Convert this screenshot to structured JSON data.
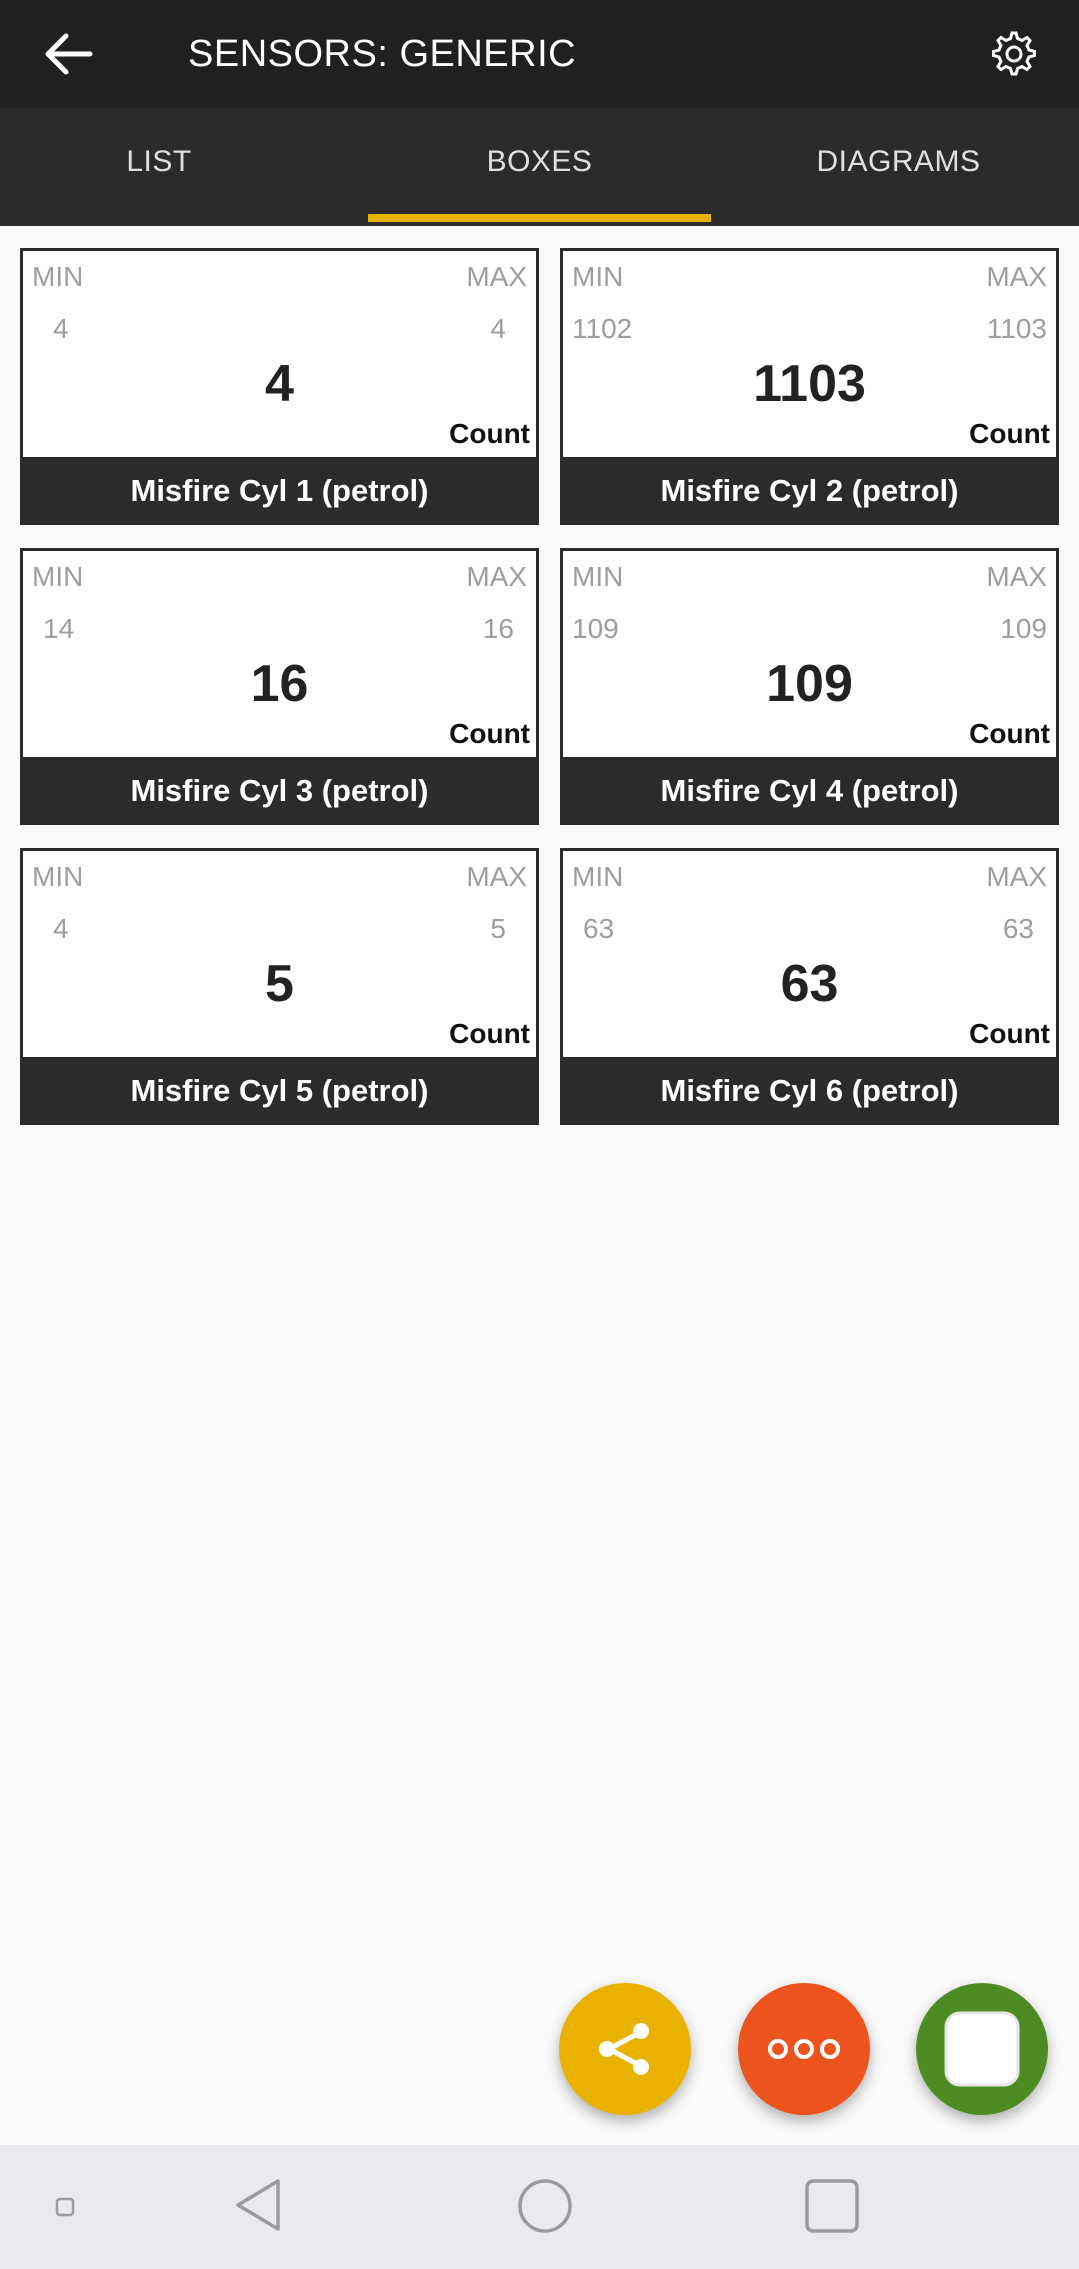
{
  "appbar": {
    "title": "SENSORS: GENERIC",
    "back_icon": "arrow-left-icon",
    "settings_icon": "gear-icon"
  },
  "tabs": [
    {
      "label": "LIST",
      "active": false
    },
    {
      "label": "BOXES",
      "active": true
    },
    {
      "label": "DIAGRAMS",
      "active": false
    }
  ],
  "colors": {
    "appbar": "#202020",
    "tabbar": "#2b2b2b",
    "accent": "#e9b200",
    "share_fab": "#e9b200",
    "more_fab": "#ec531d",
    "stop_fab": "#4d8c22"
  },
  "sensors": [
    {
      "min_label": "MIN",
      "max_label": "MAX",
      "min": "4",
      "max": "4",
      "value": "4",
      "unit": "Count",
      "name": "Misfire Cyl 1 (petrol)"
    },
    {
      "min_label": "MIN",
      "max_label": "MAX",
      "min": "1102",
      "max": "1103",
      "value": "1103",
      "unit": "Count",
      "name": "Misfire Cyl 2 (petrol)"
    },
    {
      "min_label": "MIN",
      "max_label": "MAX",
      "min": "14",
      "max": "16",
      "value": "16",
      "unit": "Count",
      "name": "Misfire Cyl 3 (petrol)"
    },
    {
      "min_label": "MIN",
      "max_label": "MAX",
      "min": "109",
      "max": "109",
      "value": "109",
      "unit": "Count",
      "name": "Misfire Cyl 4 (petrol)"
    },
    {
      "min_label": "MIN",
      "max_label": "MAX",
      "min": "4",
      "max": "5",
      "value": "5",
      "unit": "Count",
      "name": "Misfire Cyl 5 (petrol)"
    },
    {
      "min_label": "MIN",
      "max_label": "MAX",
      "min": "63",
      "max": "63",
      "value": "63",
      "unit": "Count",
      "name": "Misfire Cyl 6 (petrol)"
    }
  ],
  "fabs": {
    "share_icon": "share-icon",
    "more_icon": "more-dots-icon",
    "stop_icon": "stop-square-icon"
  },
  "navbar": {
    "icons": [
      "hide-bar-icon",
      "nav-back-icon",
      "nav-home-icon",
      "nav-recents-icon"
    ]
  }
}
